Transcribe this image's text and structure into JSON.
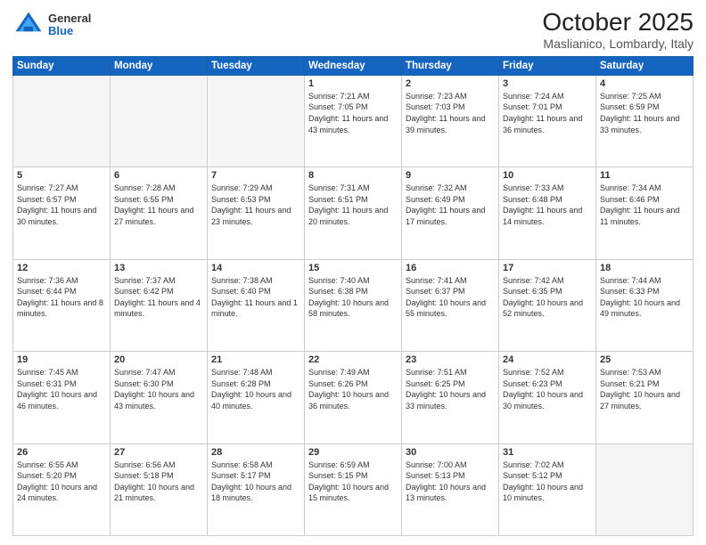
{
  "header": {
    "logo_general": "General",
    "logo_blue": "Blue",
    "title": "October 2025",
    "subtitle": "Maslianico, Lombardy, Italy"
  },
  "days_of_week": [
    "Sunday",
    "Monday",
    "Tuesday",
    "Wednesday",
    "Thursday",
    "Friday",
    "Saturday"
  ],
  "weeks": [
    [
      {
        "day": "",
        "text": ""
      },
      {
        "day": "",
        "text": ""
      },
      {
        "day": "",
        "text": ""
      },
      {
        "day": "1",
        "text": "Sunrise: 7:21 AM\nSunset: 7:05 PM\nDaylight: 11 hours and 43 minutes."
      },
      {
        "day": "2",
        "text": "Sunrise: 7:23 AM\nSunset: 7:03 PM\nDaylight: 11 hours and 39 minutes."
      },
      {
        "day": "3",
        "text": "Sunrise: 7:24 AM\nSunset: 7:01 PM\nDaylight: 11 hours and 36 minutes."
      },
      {
        "day": "4",
        "text": "Sunrise: 7:25 AM\nSunset: 6:59 PM\nDaylight: 11 hours and 33 minutes."
      }
    ],
    [
      {
        "day": "5",
        "text": "Sunrise: 7:27 AM\nSunset: 6:57 PM\nDaylight: 11 hours and 30 minutes."
      },
      {
        "day": "6",
        "text": "Sunrise: 7:28 AM\nSunset: 6:55 PM\nDaylight: 11 hours and 27 minutes."
      },
      {
        "day": "7",
        "text": "Sunrise: 7:29 AM\nSunset: 6:53 PM\nDaylight: 11 hours and 23 minutes."
      },
      {
        "day": "8",
        "text": "Sunrise: 7:31 AM\nSunset: 6:51 PM\nDaylight: 11 hours and 20 minutes."
      },
      {
        "day": "9",
        "text": "Sunrise: 7:32 AM\nSunset: 6:49 PM\nDaylight: 11 hours and 17 minutes."
      },
      {
        "day": "10",
        "text": "Sunrise: 7:33 AM\nSunset: 6:48 PM\nDaylight: 11 hours and 14 minutes."
      },
      {
        "day": "11",
        "text": "Sunrise: 7:34 AM\nSunset: 6:46 PM\nDaylight: 11 hours and 11 minutes."
      }
    ],
    [
      {
        "day": "12",
        "text": "Sunrise: 7:36 AM\nSunset: 6:44 PM\nDaylight: 11 hours and 8 minutes."
      },
      {
        "day": "13",
        "text": "Sunrise: 7:37 AM\nSunset: 6:42 PM\nDaylight: 11 hours and 4 minutes."
      },
      {
        "day": "14",
        "text": "Sunrise: 7:38 AM\nSunset: 6:40 PM\nDaylight: 11 hours and 1 minute."
      },
      {
        "day": "15",
        "text": "Sunrise: 7:40 AM\nSunset: 6:38 PM\nDaylight: 10 hours and 58 minutes."
      },
      {
        "day": "16",
        "text": "Sunrise: 7:41 AM\nSunset: 6:37 PM\nDaylight: 10 hours and 55 minutes."
      },
      {
        "day": "17",
        "text": "Sunrise: 7:42 AM\nSunset: 6:35 PM\nDaylight: 10 hours and 52 minutes."
      },
      {
        "day": "18",
        "text": "Sunrise: 7:44 AM\nSunset: 6:33 PM\nDaylight: 10 hours and 49 minutes."
      }
    ],
    [
      {
        "day": "19",
        "text": "Sunrise: 7:45 AM\nSunset: 6:31 PM\nDaylight: 10 hours and 46 minutes."
      },
      {
        "day": "20",
        "text": "Sunrise: 7:47 AM\nSunset: 6:30 PM\nDaylight: 10 hours and 43 minutes."
      },
      {
        "day": "21",
        "text": "Sunrise: 7:48 AM\nSunset: 6:28 PM\nDaylight: 10 hours and 40 minutes."
      },
      {
        "day": "22",
        "text": "Sunrise: 7:49 AM\nSunset: 6:26 PM\nDaylight: 10 hours and 36 minutes."
      },
      {
        "day": "23",
        "text": "Sunrise: 7:51 AM\nSunset: 6:25 PM\nDaylight: 10 hours and 33 minutes."
      },
      {
        "day": "24",
        "text": "Sunrise: 7:52 AM\nSunset: 6:23 PM\nDaylight: 10 hours and 30 minutes."
      },
      {
        "day": "25",
        "text": "Sunrise: 7:53 AM\nSunset: 6:21 PM\nDaylight: 10 hours and 27 minutes."
      }
    ],
    [
      {
        "day": "26",
        "text": "Sunrise: 6:55 AM\nSunset: 5:20 PM\nDaylight: 10 hours and 24 minutes."
      },
      {
        "day": "27",
        "text": "Sunrise: 6:56 AM\nSunset: 5:18 PM\nDaylight: 10 hours and 21 minutes."
      },
      {
        "day": "28",
        "text": "Sunrise: 6:58 AM\nSunset: 5:17 PM\nDaylight: 10 hours and 18 minutes."
      },
      {
        "day": "29",
        "text": "Sunrise: 6:59 AM\nSunset: 5:15 PM\nDaylight: 10 hours and 15 minutes."
      },
      {
        "day": "30",
        "text": "Sunrise: 7:00 AM\nSunset: 5:13 PM\nDaylight: 10 hours and 13 minutes."
      },
      {
        "day": "31",
        "text": "Sunrise: 7:02 AM\nSunset: 5:12 PM\nDaylight: 10 hours and 10 minutes."
      },
      {
        "day": "",
        "text": ""
      }
    ]
  ]
}
